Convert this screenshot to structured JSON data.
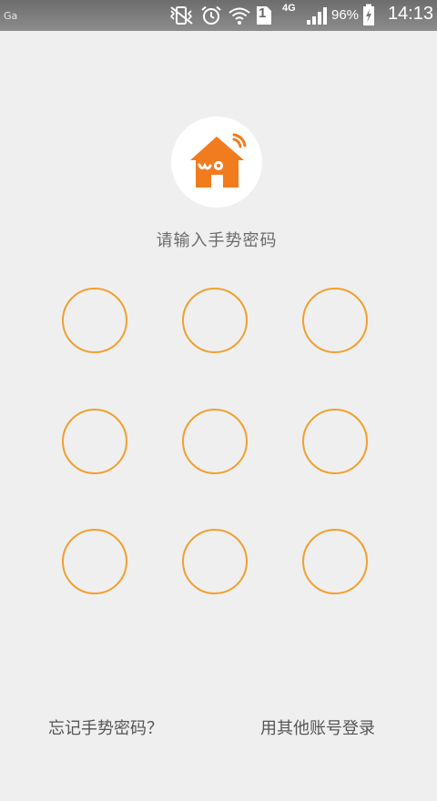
{
  "status_bar": {
    "carrier_icon_text": "Ga",
    "network_type": "4G",
    "sim_slot": "1",
    "battery": "96%",
    "time": "14:13"
  },
  "header": {
    "logo_icon": "wo-home-icon",
    "prompt": "请输入手势密码"
  },
  "gesture_grid": {
    "dots": [
      "1",
      "2",
      "3",
      "4",
      "5",
      "6",
      "7",
      "8",
      "9"
    ],
    "ring_color": "#f0a030"
  },
  "footer": {
    "forgot_label": "忘记手势密码？",
    "other_account_label": "用其他账号登录"
  },
  "colors": {
    "accent": "#f07c1e",
    "background": "#efefef"
  }
}
